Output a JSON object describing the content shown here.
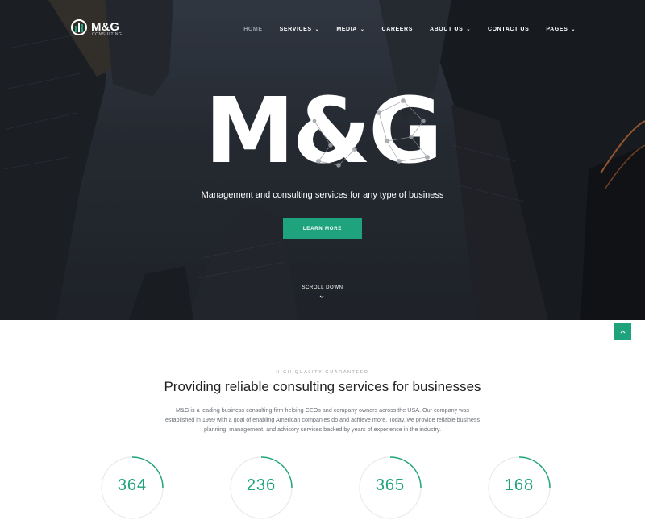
{
  "brand": {
    "name": "M&G",
    "sub": "CONSULTING"
  },
  "nav": {
    "items": [
      {
        "label": "HOME",
        "dropdown": false,
        "active": true
      },
      {
        "label": "SERVICES",
        "dropdown": true
      },
      {
        "label": "MEDIA",
        "dropdown": true
      },
      {
        "label": "CAREERS",
        "dropdown": false
      },
      {
        "label": "ABOUT US",
        "dropdown": true
      },
      {
        "label": "CONTACT US",
        "dropdown": false
      },
      {
        "label": "PAGES",
        "dropdown": true
      }
    ],
    "caret": "⌄"
  },
  "hero": {
    "title": "M&G",
    "tagline": "Management and consulting services for any type of business",
    "cta": "LEARN MORE",
    "scroll": "SCROLL DOWN"
  },
  "intro": {
    "eyebrow": "HIGH QUALITY GUARANTEED",
    "heading": "Providing reliable consulting services for businesses",
    "body": "M&G is a leading business consulting firm helping CEOs and company owners across the USA. Our company was established in 1999 with a goal of enabling American companies do and achieve more. Today, we provide reliable business planning, management, and advisory services backed by years of experience in the industry."
  },
  "stats": [
    {
      "value": "364"
    },
    {
      "value": "236"
    },
    {
      "value": "365"
    },
    {
      "value": "168"
    }
  ],
  "colors": {
    "accent": "#1fa37c",
    "heading": "#222222",
    "body": "#6a6f75"
  },
  "icons": {
    "scroll": "chevron-down-icon",
    "back_to_top": "chevron-up-icon",
    "logo": "logo-icon"
  }
}
